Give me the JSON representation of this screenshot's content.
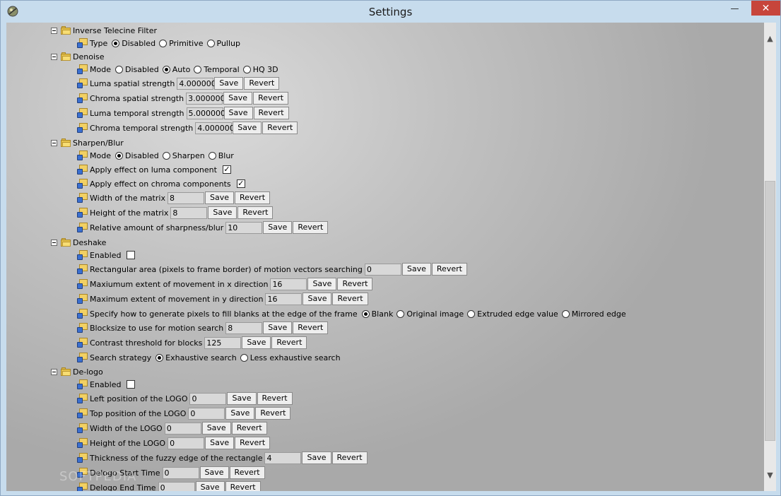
{
  "window": {
    "title": "Settings",
    "close_label": "✕",
    "min_label": "—",
    "max_label": "▢"
  },
  "watermark": "SOFTPEDIA",
  "sections": {
    "ivtc": {
      "title": "Inverse Telecine Filter",
      "type_label": "Type",
      "opts": [
        "Disabled",
        "Primitive",
        "Pullup"
      ]
    },
    "denoise": {
      "title": "Denoise",
      "mode_label": "Mode",
      "opts": [
        "Disabled",
        "Auto",
        "Temporal",
        "HQ 3D"
      ],
      "luma_spatial": {
        "label": "Luma spatial strength",
        "value": "4.000000"
      },
      "chroma_spatial": {
        "label": "Chroma spatial strength",
        "value": "3.000000"
      },
      "luma_temporal": {
        "label": "Luma temporal strength",
        "value": "5.000000"
      },
      "chroma_temporal": {
        "label": "Chroma temporal strength",
        "value": "4.000000"
      }
    },
    "sharpen": {
      "title": "Sharpen/Blur",
      "mode_label": "Mode",
      "opts": [
        "Disabled",
        "Sharpen",
        "Blur"
      ],
      "apply_luma": {
        "label": "Apply effect on luma component",
        "checked": true
      },
      "apply_chroma": {
        "label": "Apply effect on chroma components",
        "checked": true
      },
      "width": {
        "label": "Width of the matrix",
        "value": "8"
      },
      "height": {
        "label": "Height of the matrix",
        "value": "8"
      },
      "amount": {
        "label": "Relative amount of sharpness/blur",
        "value": "10"
      }
    },
    "deshake": {
      "title": "Deshake",
      "enabled": {
        "label": "Enabled",
        "checked": false
      },
      "rect": {
        "label": "Rectangular area (pixels to frame border) of motion vectors searching",
        "value": "0"
      },
      "max_x": {
        "label": "Maxiumum extent of movement in x direction",
        "value": "16"
      },
      "max_y": {
        "label": "Maximum extent of movement in y direction",
        "value": "16"
      },
      "fill": {
        "label": "Specify how to generate pixels to fill blanks at the edge of the frame",
        "opts": [
          "Blank",
          "Original image",
          "Extruded edge value",
          "Mirrored edge"
        ]
      },
      "blocksize": {
        "label": "Blocksize to use for motion search",
        "value": "8"
      },
      "contrast": {
        "label": "Contrast threshold for blocks",
        "value": "125"
      },
      "strategy": {
        "label": "Search strategy",
        "opts": [
          "Exhaustive search",
          "Less exhaustive search"
        ]
      }
    },
    "delogo": {
      "title": "De-logo",
      "enabled": {
        "label": "Enabled",
        "checked": false
      },
      "left": {
        "label": "Left position of the LOGO",
        "value": "0"
      },
      "top": {
        "label": "Top position of the LOGO",
        "value": "0"
      },
      "width": {
        "label": "Width of the LOGO",
        "value": "0"
      },
      "height": {
        "label": "Height of the LOGO",
        "value": "0"
      },
      "fuzzy": {
        "label": "Thickness of the fuzzy edge of the rectangle",
        "value": "4"
      },
      "start": {
        "label": "Delogo Start Time",
        "value": "0"
      },
      "end": {
        "label": "Delogo End Time",
        "value": "0"
      }
    }
  },
  "buttons": {
    "save": "Save",
    "revert": "Revert"
  },
  "checkmark": "✓"
}
